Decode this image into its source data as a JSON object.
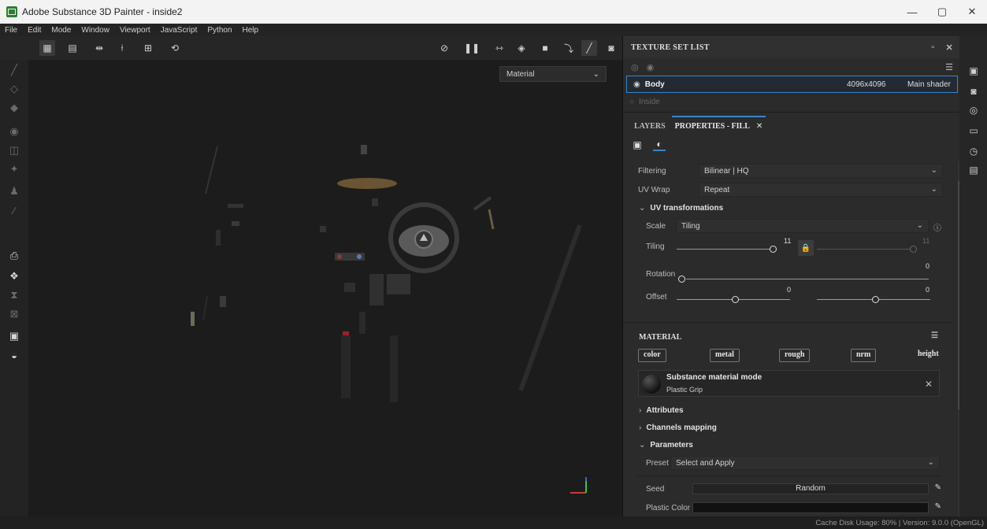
{
  "window": {
    "title": "Adobe Substance 3D Painter - inside2",
    "controls": [
      "—",
      "▢",
      "✕"
    ]
  },
  "menu": [
    "File",
    "Edit",
    "Mode",
    "Window",
    "Viewport",
    "JavaScript",
    "Python",
    "Help"
  ],
  "viewport": {
    "material_select": "Material"
  },
  "texture_set_list": {
    "title": "TEXTURE SET LIST",
    "rows": [
      {
        "name": "Body",
        "size": "4096x4096",
        "shader": "Main shader",
        "selected": true
      },
      {
        "name": "Inside",
        "size": "",
        "shader": "",
        "selected": false
      }
    ]
  },
  "tabs": {
    "layers": "LAYERS",
    "properties": "PROPERTIES - FILL",
    "close": "✕"
  },
  "properties": {
    "filtering_label": "Filtering",
    "filtering_value": "Bilinear | HQ",
    "uvwrap_label": "UV Wrap",
    "uvwrap_value": "Repeat",
    "uv_section": "UV transformations",
    "scale_label": "Scale",
    "scale_value": "Tiling",
    "tiling_label": "Tiling",
    "tiling_value": "11",
    "tiling_value2": "11",
    "rotation_label": "Rotation",
    "rotation_value": "0",
    "offset_label": "Offset",
    "offset_value_u": "0",
    "offset_value_v": "0"
  },
  "material": {
    "title": "MATERIAL",
    "channels": [
      "color",
      "metal",
      "rough",
      "nrm",
      "height"
    ],
    "mode_title": "Substance material mode",
    "mode_subtitle": "Plastic Grip",
    "sections": {
      "attributes": "Attributes",
      "channels_mapping": "Channels mapping",
      "parameters": "Parameters"
    },
    "preset_label": "Preset",
    "preset_value": "Select and Apply",
    "seed_label": "Seed",
    "seed_value": "Random",
    "plastic_color_label": "Plastic Color"
  },
  "status": "Cache Disk Usage:  80% | Version: 9.0.0 (OpenGL)"
}
